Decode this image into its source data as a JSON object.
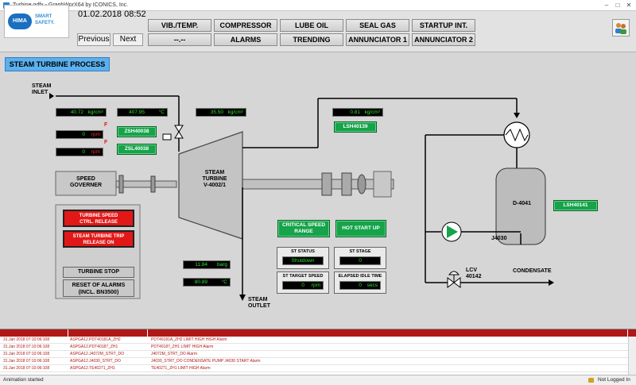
{
  "window": {
    "title": "Turbine.gdfx - GraphWorX64 by ICONICS, Inc."
  },
  "header": {
    "logo": {
      "brand": "HIMA",
      "tagline": "SMART SAFETY."
    },
    "datetime": "01.02.2018 08:52",
    "previous": "Previous",
    "next": "Next",
    "menu_row1": [
      "VIB./TEMP.",
      "COMPRESSOR",
      "LUBE OIL",
      "SEAL GAS",
      "STARTUP INT."
    ],
    "menu_row2": [
      "--.--",
      "ALARMS",
      "TRENDING",
      "ANNUNCIATOR 1",
      "ANNUNCIATOR 2"
    ]
  },
  "page": {
    "title": "STEAM TURBINE PROCESS"
  },
  "process": {
    "steam_inlet": "STEAM\nINLET",
    "steam_outlet": "STEAM\nOUTLET",
    "speed_governer": "SPEED\nGOVERNER",
    "turbine": "STEAM\nTURBINE\nV-4002/1",
    "vessel": "D-4041",
    "pump": "J4030",
    "valve_tag": "LCV\n40142",
    "condensate": "CONDENSATE",
    "displays": [
      {
        "value": "40.72",
        "unit": "kg/cm²"
      },
      {
        "value": "407.95",
        "unit": "°C"
      },
      {
        "value": "35.50",
        "unit": "kg/cm²"
      },
      {
        "value": "0.81",
        "unit": "kg/cm²"
      },
      {
        "value": "0",
        "unit": "rpm",
        "flag": "F"
      },
      {
        "value": "0",
        "unit": "rpm",
        "flag": "F"
      },
      {
        "value": "11.84",
        "unit": "barg"
      },
      {
        "value": "80.89",
        "unit": "°C"
      }
    ],
    "switches": {
      "zsh": "ZSH40038",
      "zsl": "ZSL40038",
      "lsh1": "LSH40139",
      "lsh2": "LSH40141"
    },
    "buttons": {
      "critical_speed": "CRITICAL SPEED\nRANGE",
      "hot_start": "HOT START UP",
      "turbine_speed": "TURBINE SPEED\nCTRL. RELEASE",
      "trip_release": "STEAM TURBINE TRIP\nRELEASE ON",
      "turbine_stop": "TURBINE STOP",
      "reset_alarms": "RESET OF ALARMS\n(INCL. BN3500)"
    },
    "status": {
      "st_status_label": "ST STATUS",
      "st_status": "Shutdown",
      "st_stage_label": "ST STAGE",
      "st_stage": "0",
      "st_target_label": "ST TARGET SPEED",
      "st_target": "0",
      "st_target_unit": "rpm",
      "idle_label": "ELAPSED IDLE TIME",
      "idle": "0",
      "idle_unit": "secs"
    }
  },
  "alarm_table": {
    "columns": [
      "",
      "",
      ""
    ],
    "rows": [
      {
        "time": "31.Jan 2018 07:10:06:108",
        "tag": "ASPGA12.PDT40181A_ZH2",
        "desc": "PDT40181A_ZH2 LIMIT HIGH HIGH Alarm"
      },
      {
        "time": "31.Jan 2018 07:10:06:108",
        "tag": "ASPGA12.PDT40187_ZH1",
        "desc": "PDT40187_ZH1 LIMIT HIGH Alarm"
      },
      {
        "time": "31.Jan 2018 07:10:06:108",
        "tag": "ASPGA12.J4072M_STRT_DO",
        "desc": "J4072M_STRT_DO Alarm"
      },
      {
        "time": "31.Jan 2018 07:10:06:108",
        "tag": "ASPGA12.J4030_STRT_DO",
        "desc": "J4030_STRT_DO CONDENSATE PUMP J4030 START Alarm"
      },
      {
        "time": "31.Jan 2018 07:10:06:108",
        "tag": "ASPGA12.TE40271_ZH1",
        "desc": "TE40271_ZH1 LIMIT HIGH Alarm"
      }
    ]
  },
  "statusbar": {
    "left": "Animation started",
    "right": "Not Logged In"
  },
  "colors": {
    "accent": "#5bb0ee",
    "ok_green": "#16a34a",
    "alarm_red": "#b01818",
    "display_green": "#2fe02f"
  }
}
